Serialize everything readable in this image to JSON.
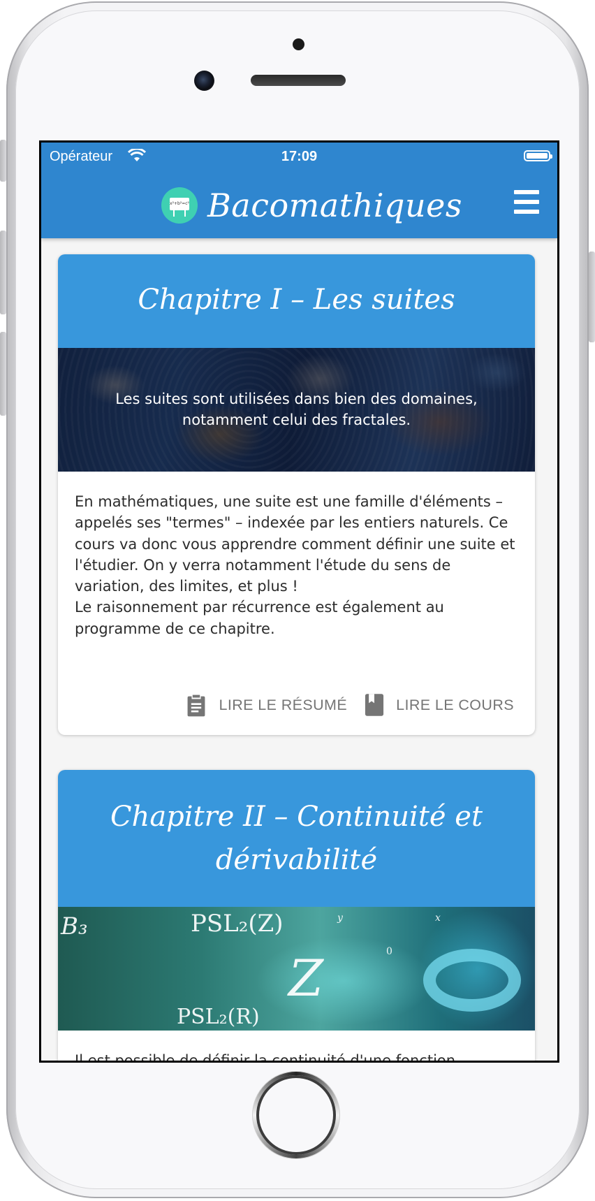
{
  "status_bar": {
    "carrier": "Opérateur",
    "time": "17:09"
  },
  "app_bar": {
    "title": "Bacomathiques",
    "logo_text": "x²+b²=c²"
  },
  "chapters": [
    {
      "title": "Chapitre I – Les suites",
      "banner_text": "Les suites sont utilisées dans bien des domaines, notamment celui des fractales.",
      "description_lines": [
        "En mathématiques, une suite est une famille d'éléments – appelés ses \"termes\" – indexée par les entiers naturels. Ce cours va donc vous apprendre comment définir une suite et l'étudier. On y verra notamment l'étude du sens de variation, des limites, et plus !",
        "Le raisonnement par récurrence est également au programme de ce chapitre."
      ],
      "actions": {
        "summary": "LIRE LE RÉSUMÉ",
        "course": "LIRE LE COURS"
      }
    },
    {
      "title": "Chapitre II – Continuité et dérivabilité",
      "banner_text": "B₃ PSL₂(Z) Z PSL₂(R) 0 y x",
      "description_partial": "Il est possible de définir la continuité d'une fonction"
    }
  ],
  "colors": {
    "app_bar": "#2f86cf",
    "card_header": "#3897dc",
    "action_text": "#757575",
    "background": "#f5f5f5"
  },
  "icons": [
    "wifi-icon",
    "battery-icon",
    "menu-icon",
    "clipboard-icon",
    "book-icon"
  ]
}
